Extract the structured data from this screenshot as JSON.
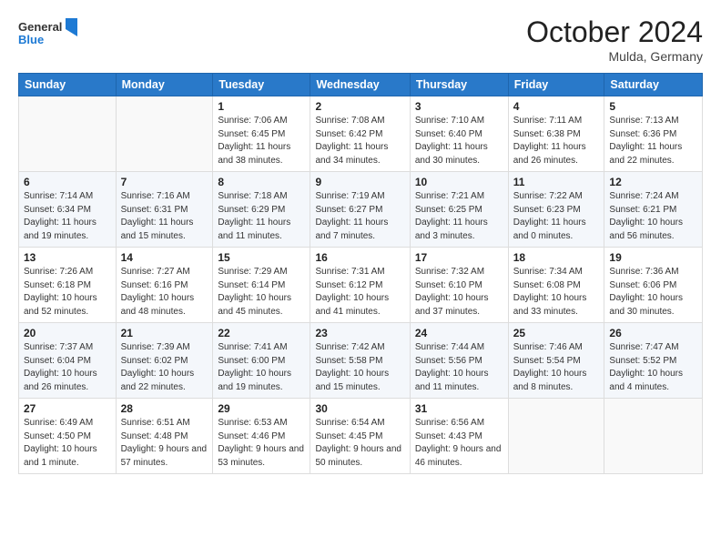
{
  "header": {
    "logo_general": "General",
    "logo_blue": "Blue",
    "month_title": "October 2024",
    "location": "Mulda, Germany"
  },
  "weekdays": [
    "Sunday",
    "Monday",
    "Tuesday",
    "Wednesday",
    "Thursday",
    "Friday",
    "Saturday"
  ],
  "weeks": [
    [
      {
        "day": "",
        "sunrise": "",
        "sunset": "",
        "daylight": ""
      },
      {
        "day": "",
        "sunrise": "",
        "sunset": "",
        "daylight": ""
      },
      {
        "day": "1",
        "sunrise": "Sunrise: 7:06 AM",
        "sunset": "Sunset: 6:45 PM",
        "daylight": "Daylight: 11 hours and 38 minutes."
      },
      {
        "day": "2",
        "sunrise": "Sunrise: 7:08 AM",
        "sunset": "Sunset: 6:42 PM",
        "daylight": "Daylight: 11 hours and 34 minutes."
      },
      {
        "day": "3",
        "sunrise": "Sunrise: 7:10 AM",
        "sunset": "Sunset: 6:40 PM",
        "daylight": "Daylight: 11 hours and 30 minutes."
      },
      {
        "day": "4",
        "sunrise": "Sunrise: 7:11 AM",
        "sunset": "Sunset: 6:38 PM",
        "daylight": "Daylight: 11 hours and 26 minutes."
      },
      {
        "day": "5",
        "sunrise": "Sunrise: 7:13 AM",
        "sunset": "Sunset: 6:36 PM",
        "daylight": "Daylight: 11 hours and 22 minutes."
      }
    ],
    [
      {
        "day": "6",
        "sunrise": "Sunrise: 7:14 AM",
        "sunset": "Sunset: 6:34 PM",
        "daylight": "Daylight: 11 hours and 19 minutes."
      },
      {
        "day": "7",
        "sunrise": "Sunrise: 7:16 AM",
        "sunset": "Sunset: 6:31 PM",
        "daylight": "Daylight: 11 hours and 15 minutes."
      },
      {
        "day": "8",
        "sunrise": "Sunrise: 7:18 AM",
        "sunset": "Sunset: 6:29 PM",
        "daylight": "Daylight: 11 hours and 11 minutes."
      },
      {
        "day": "9",
        "sunrise": "Sunrise: 7:19 AM",
        "sunset": "Sunset: 6:27 PM",
        "daylight": "Daylight: 11 hours and 7 minutes."
      },
      {
        "day": "10",
        "sunrise": "Sunrise: 7:21 AM",
        "sunset": "Sunset: 6:25 PM",
        "daylight": "Daylight: 11 hours and 3 minutes."
      },
      {
        "day": "11",
        "sunrise": "Sunrise: 7:22 AM",
        "sunset": "Sunset: 6:23 PM",
        "daylight": "Daylight: 11 hours and 0 minutes."
      },
      {
        "day": "12",
        "sunrise": "Sunrise: 7:24 AM",
        "sunset": "Sunset: 6:21 PM",
        "daylight": "Daylight: 10 hours and 56 minutes."
      }
    ],
    [
      {
        "day": "13",
        "sunrise": "Sunrise: 7:26 AM",
        "sunset": "Sunset: 6:18 PM",
        "daylight": "Daylight: 10 hours and 52 minutes."
      },
      {
        "day": "14",
        "sunrise": "Sunrise: 7:27 AM",
        "sunset": "Sunset: 6:16 PM",
        "daylight": "Daylight: 10 hours and 48 minutes."
      },
      {
        "day": "15",
        "sunrise": "Sunrise: 7:29 AM",
        "sunset": "Sunset: 6:14 PM",
        "daylight": "Daylight: 10 hours and 45 minutes."
      },
      {
        "day": "16",
        "sunrise": "Sunrise: 7:31 AM",
        "sunset": "Sunset: 6:12 PM",
        "daylight": "Daylight: 10 hours and 41 minutes."
      },
      {
        "day": "17",
        "sunrise": "Sunrise: 7:32 AM",
        "sunset": "Sunset: 6:10 PM",
        "daylight": "Daylight: 10 hours and 37 minutes."
      },
      {
        "day": "18",
        "sunrise": "Sunrise: 7:34 AM",
        "sunset": "Sunset: 6:08 PM",
        "daylight": "Daylight: 10 hours and 33 minutes."
      },
      {
        "day": "19",
        "sunrise": "Sunrise: 7:36 AM",
        "sunset": "Sunset: 6:06 PM",
        "daylight": "Daylight: 10 hours and 30 minutes."
      }
    ],
    [
      {
        "day": "20",
        "sunrise": "Sunrise: 7:37 AM",
        "sunset": "Sunset: 6:04 PM",
        "daylight": "Daylight: 10 hours and 26 minutes."
      },
      {
        "day": "21",
        "sunrise": "Sunrise: 7:39 AM",
        "sunset": "Sunset: 6:02 PM",
        "daylight": "Daylight: 10 hours and 22 minutes."
      },
      {
        "day": "22",
        "sunrise": "Sunrise: 7:41 AM",
        "sunset": "Sunset: 6:00 PM",
        "daylight": "Daylight: 10 hours and 19 minutes."
      },
      {
        "day": "23",
        "sunrise": "Sunrise: 7:42 AM",
        "sunset": "Sunset: 5:58 PM",
        "daylight": "Daylight: 10 hours and 15 minutes."
      },
      {
        "day": "24",
        "sunrise": "Sunrise: 7:44 AM",
        "sunset": "Sunset: 5:56 PM",
        "daylight": "Daylight: 10 hours and 11 minutes."
      },
      {
        "day": "25",
        "sunrise": "Sunrise: 7:46 AM",
        "sunset": "Sunset: 5:54 PM",
        "daylight": "Daylight: 10 hours and 8 minutes."
      },
      {
        "day": "26",
        "sunrise": "Sunrise: 7:47 AM",
        "sunset": "Sunset: 5:52 PM",
        "daylight": "Daylight: 10 hours and 4 minutes."
      }
    ],
    [
      {
        "day": "27",
        "sunrise": "Sunrise: 6:49 AM",
        "sunset": "Sunset: 4:50 PM",
        "daylight": "Daylight: 10 hours and 1 minute."
      },
      {
        "day": "28",
        "sunrise": "Sunrise: 6:51 AM",
        "sunset": "Sunset: 4:48 PM",
        "daylight": "Daylight: 9 hours and 57 minutes."
      },
      {
        "day": "29",
        "sunrise": "Sunrise: 6:53 AM",
        "sunset": "Sunset: 4:46 PM",
        "daylight": "Daylight: 9 hours and 53 minutes."
      },
      {
        "day": "30",
        "sunrise": "Sunrise: 6:54 AM",
        "sunset": "Sunset: 4:45 PM",
        "daylight": "Daylight: 9 hours and 50 minutes."
      },
      {
        "day": "31",
        "sunrise": "Sunrise: 6:56 AM",
        "sunset": "Sunset: 4:43 PM",
        "daylight": "Daylight: 9 hours and 46 minutes."
      },
      {
        "day": "",
        "sunrise": "",
        "sunset": "",
        "daylight": ""
      },
      {
        "day": "",
        "sunrise": "",
        "sunset": "",
        "daylight": ""
      }
    ]
  ]
}
